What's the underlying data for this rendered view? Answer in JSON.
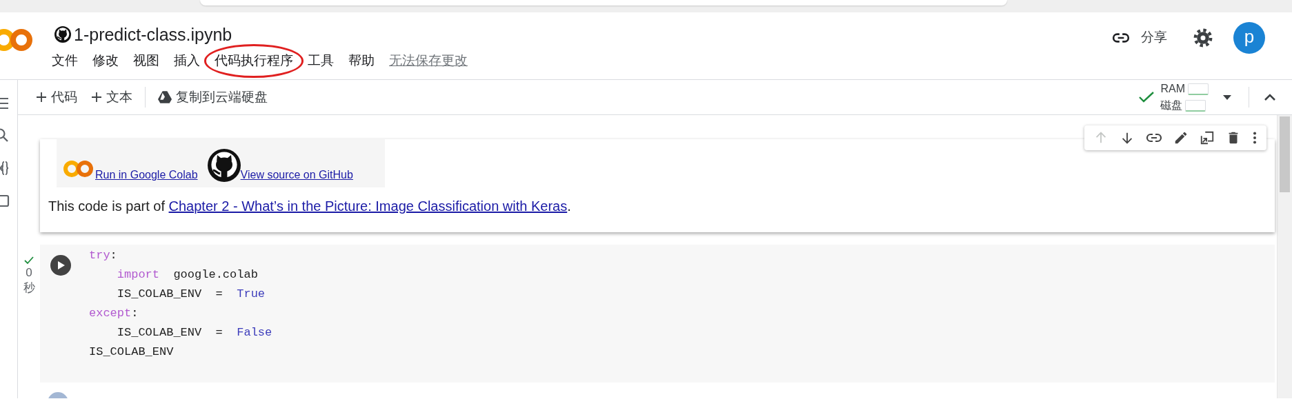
{
  "notebook": {
    "title": "1-predict-class.ipynb"
  },
  "menu": [
    {
      "label": "文件",
      "kind": "menu",
      "circled": false
    },
    {
      "label": "修改",
      "kind": "menu",
      "circled": false
    },
    {
      "label": "视图",
      "kind": "menu",
      "circled": false
    },
    {
      "label": "插入",
      "kind": "menu",
      "circled": false
    },
    {
      "label": "代码执行程序",
      "kind": "menu",
      "circled": true
    },
    {
      "label": "工具",
      "kind": "menu",
      "circled": false
    },
    {
      "label": "帮助",
      "kind": "menu",
      "circled": false
    },
    {
      "label": "无法保存更改",
      "kind": "notice",
      "circled": false
    }
  ],
  "header": {
    "share": "分享",
    "avatar": "p"
  },
  "toolbar": {
    "buttons": [
      {
        "kind": "add",
        "label": "代码"
      },
      {
        "kind": "add",
        "label": "文本"
      },
      {
        "kind": "drive",
        "label": "复制到云端硬盘"
      }
    ],
    "connected": true,
    "resources": [
      "RAM",
      "磁盘"
    ]
  },
  "cells": [
    {
      "kind": "text",
      "selected": true,
      "cell_toolbar": [
        {
          "kind": "move-up",
          "disabled": true
        },
        {
          "kind": "move-down",
          "disabled": false
        },
        {
          "kind": "link",
          "disabled": false
        },
        {
          "kind": "edit",
          "disabled": false
        },
        {
          "kind": "mirror",
          "disabled": false
        },
        {
          "kind": "delete",
          "disabled": false
        },
        {
          "kind": "more",
          "disabled": false
        }
      ],
      "badges": [
        {
          "kind": "colab",
          "label": "Run in Google Colab"
        },
        {
          "kind": "github",
          "label": "View source on GitHub"
        }
      ],
      "intro": "This code is part of ",
      "link": "Chapter 2 - What’s in the Picture: Image Classification with Keras",
      "outro": "."
    },
    {
      "kind": "code",
      "selected": false,
      "executed": true,
      "duration": "0",
      "unit": "秒",
      "lines": [
        {
          "indented": false,
          "tokens": [
            {
              "text": "try",
              "color": "#b25bd0"
            },
            {
              "text": ":",
              "color": "#212121"
            }
          ]
        },
        {
          "indented": true,
          "tokens": [
            {
              "text": "import",
              "color": "#b25bd0"
            },
            {
              "text": "  google.colab",
              "color": "#212121"
            }
          ]
        },
        {
          "indented": true,
          "tokens": [
            {
              "text": "IS_COLAB_ENV  =  ",
              "color": "#212121"
            },
            {
              "text": "True",
              "color": "#3d3dbb"
            }
          ]
        },
        {
          "indented": false,
          "tokens": [
            {
              "text": "except",
              "color": "#b25bd0"
            },
            {
              "text": ":",
              "color": "#212121"
            }
          ]
        },
        {
          "indented": true,
          "tokens": [
            {
              "text": "IS_COLAB_ENV  =  ",
              "color": "#212121"
            },
            {
              "text": "False",
              "color": "#3d3dbb"
            }
          ]
        },
        {
          "indented": false,
          "tokens": [
            {
              "text": "IS_COLAB_ENV",
              "color": "#212121"
            }
          ]
        }
      ]
    }
  ]
}
